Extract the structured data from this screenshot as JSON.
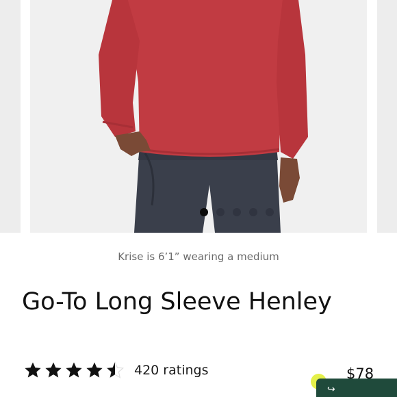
{
  "gallery": {
    "image_alt": "Model wearing a red long sleeve henley and charcoal pants",
    "dots_total": 5,
    "active_dot": 1
  },
  "caption": "Krise is 6’1” wearing a medium",
  "product": {
    "title": "Go-To Long Sleeve Henley",
    "rating": 4.5,
    "ratings_count_label": "420 ratings",
    "price": "$78"
  },
  "colors": {
    "shirt": "#c13b42",
    "pants": "#3a3f4b",
    "star": "#111111",
    "fab_dot": "#e4f04a",
    "chat_widget": "#1f4a3b"
  },
  "icons": {
    "star": "star-icon",
    "chat": "chat-icon"
  }
}
